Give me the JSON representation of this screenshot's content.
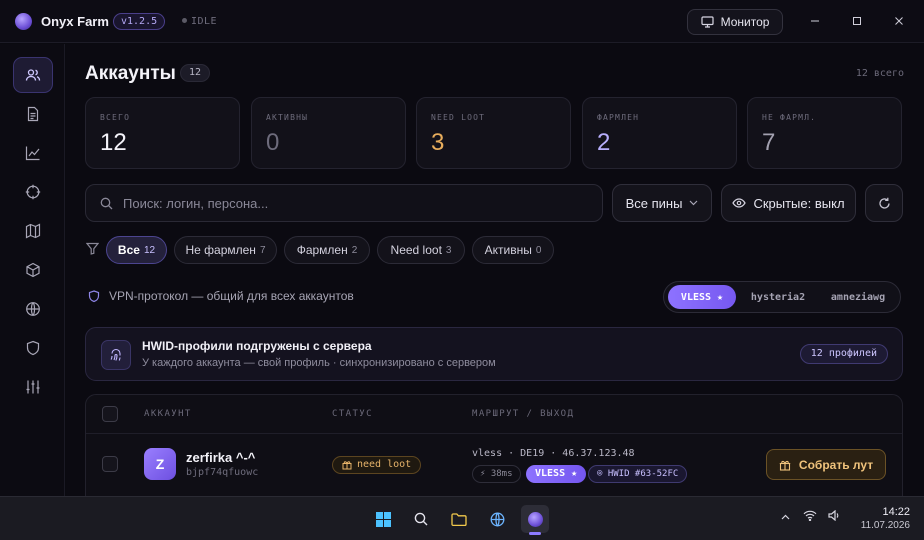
{
  "titlebar": {
    "app_title": "Onyx Farm",
    "version": "v1.2.5",
    "state": "IDLE",
    "monitor_label": "Монитор",
    "controls": [
      "minimize",
      "maximize",
      "close"
    ]
  },
  "sidebar": {
    "items": [
      {
        "icon": "users-icon",
        "active": true
      },
      {
        "icon": "document-icon",
        "active": false
      },
      {
        "icon": "chart-icon",
        "active": false
      },
      {
        "icon": "crosshair-icon",
        "active": false
      },
      {
        "icon": "map-icon",
        "active": false
      },
      {
        "icon": "cube-icon",
        "active": false
      },
      {
        "icon": "globe-icon",
        "active": false
      },
      {
        "icon": "shield-icon",
        "active": false
      },
      {
        "icon": "sliders-icon",
        "active": false
      }
    ]
  },
  "page": {
    "title": "Аккаунты",
    "title_count": "12",
    "total_text": "12 всего"
  },
  "stats": [
    {
      "label": "ВСЕГО",
      "value": "12",
      "color": "#f4f3f9"
    },
    {
      "label": "АКТИВНЫ",
      "value": "0",
      "color": "#6d6b7b"
    },
    {
      "label": "NEED LOOT",
      "value": "3",
      "color": "#e7ad5c"
    },
    {
      "label": "ФАРМЛЕН",
      "value": "2",
      "color": "#b7aefc"
    },
    {
      "label": "НЕ ФАРМЛ.",
      "value": "7",
      "color": "#a3a1b0"
    }
  ],
  "search": {
    "placeholder": "Поиск: логин, персона..."
  },
  "pins_dropdown": {
    "label": "Все пины"
  },
  "hidden_toggle": {
    "label": "Скрытые: выкл"
  },
  "filters": [
    {
      "label": "Все",
      "count": "12",
      "active": true
    },
    {
      "label": "Не фармлен",
      "count": "7",
      "active": false
    },
    {
      "label": "Фармлен",
      "count": "2",
      "active": false
    },
    {
      "label": "Need loot",
      "count": "3",
      "active": false
    },
    {
      "label": "Активны",
      "count": "0",
      "active": false
    }
  ],
  "vpn": {
    "label": "VPN-протокол — общий для всех аккаунтов",
    "options": [
      {
        "label": "VLESS ★",
        "active": true
      },
      {
        "label": "hysteria2",
        "active": false
      },
      {
        "label": "amneziawg",
        "active": false
      }
    ]
  },
  "hwid_banner": {
    "title": "HWID-профили подгружены с сервера",
    "subtitle": "У каждого аккаунта — свой профиль · синхронизировано с сервером",
    "badge": "12 профилей"
  },
  "table": {
    "headers": {
      "account": "АККАУНТ",
      "status": "СТАТУС",
      "route": "МАРШРУТ / ВЫХОД"
    },
    "rows": [
      {
        "avatar_letter": "Z",
        "name": "zerfirka ^-^",
        "id": "bjpf74qfuowc",
        "status": "need loot",
        "route": "vless · DE19 · 46.37.123.48",
        "ping": "38ms",
        "protocol": "VLESS ★",
        "hwid": "HWID #63-52FC",
        "action": "Собрать лут"
      }
    ]
  },
  "taskbar": {
    "time": "14:22",
    "date": "11.07.2026"
  }
}
